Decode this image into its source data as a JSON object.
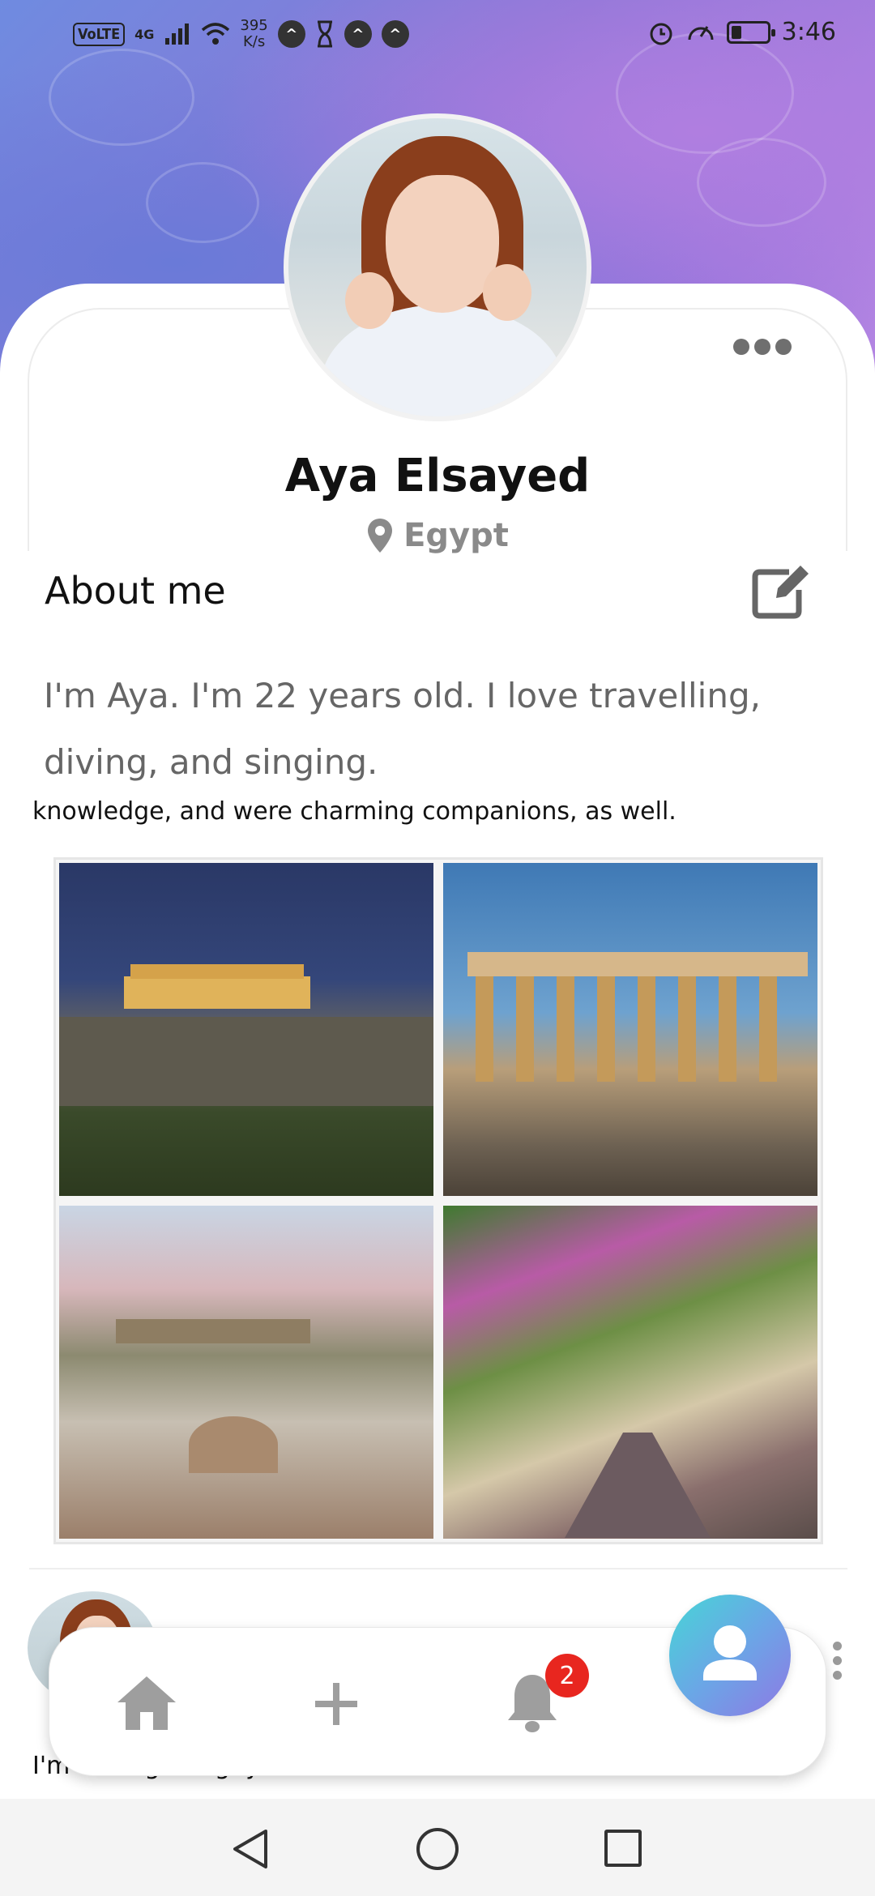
{
  "status_bar": {
    "volte": "VoLTE",
    "network": "4G",
    "speed_value": "395",
    "speed_unit": "K/s",
    "time": "3:46"
  },
  "profile": {
    "name": "Aya Elsayed",
    "location": "Egypt"
  },
  "about": {
    "title": "About me",
    "text": "I'm Aya. I'm 22 years old. I love travelling, diving, and singing."
  },
  "post_caption": "knowledge, and were charming companions, as well.",
  "post_text": "I'm having fun guyssss",
  "notifications_count": "2",
  "icons": {
    "more": "more-horizontal-icon",
    "location": "location-pin-icon",
    "edit": "edit-icon",
    "home": "home-icon",
    "add": "plus-icon",
    "bell": "bell-icon",
    "profile": "person-icon",
    "post_menu": "more-vertical-icon",
    "back": "back-triangle-icon",
    "home_circle": "home-circle-icon",
    "recents": "recents-square-icon"
  },
  "colors": {
    "badge": "#e8261f",
    "fab_gradient_start": "#46d6d6",
    "fab_gradient_end": "#8f78e4",
    "muted_text": "#8a8a8a"
  }
}
